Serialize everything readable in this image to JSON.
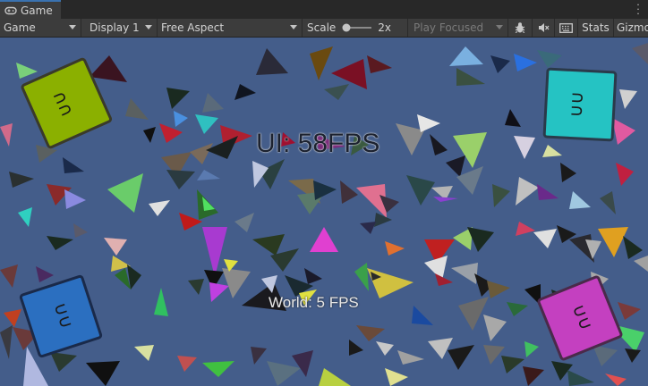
{
  "tab": {
    "label": "Game",
    "icon": "gamepad-icon"
  },
  "toolbar": {
    "mode": "Game",
    "display": "Display 1",
    "aspect": "Free Aspect",
    "scale_label": "Scale",
    "scale_value": "2x",
    "play_focus": "Play Focused",
    "stats": "Stats",
    "gizmos": "Gizmo"
  },
  "overlay": {
    "ui_fps": "UI: 58FPS",
    "world_fps": "World: 5 FPS"
  },
  "cards": [
    {
      "color": "#8bb000",
      "glyph": "∩∩"
    },
    {
      "color": "#25c3c3",
      "glyph": "∩∩"
    },
    {
      "color": "#2b6fc0",
      "glyph": "∩∩"
    },
    {
      "color": "#c440c0",
      "glyph": "∩∩"
    }
  ],
  "colors": {
    "viewport_bg": "#445d8a",
    "tab_accent": "#3a72b0"
  }
}
